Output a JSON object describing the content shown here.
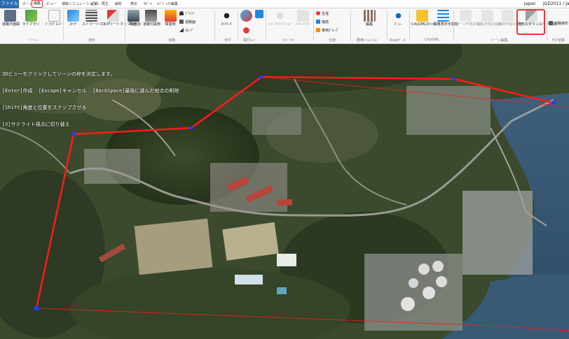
{
  "tabs": {
    "file": "ファイル",
    "items": [
      "ホーム",
      "編集",
      "ビュー",
      "運転シミュレーション",
      "記録／再生",
      "解析",
      "表示",
      "ｻﾎﾟｰﾄ",
      "ｵﾌﾞｼﾞｪｸﾄ編集"
    ],
    "active": "編集"
  },
  "status": {
    "lang": "Japan",
    "crs": "JGD2011 / Ja"
  },
  "ribbon": {
    "zone_group": {
      "label": "ゾーン",
      "roadplan": "道路平面図",
      "library": "ライブラリ",
      "drag_mode": "ﾄﾞﾗｯｸﾞﾓｰﾄﾞ"
    },
    "terrain_group": {
      "label": "地形",
      "sketch": "ｽｹｯﾁ",
      "street_map": "ストリートマップ",
      "street_map_split": "ストリートマップの分割"
    },
    "road_group": {
      "label": "道路",
      "section": "断面",
      "road_features": "道路付属物",
      "obstacles": "障害物",
      "bridge": "ﾌﾞﾘｯｼﾞ",
      "road_plane": "道路面",
      "slope": "ｽﾛｰﾌﾟ"
    },
    "walk_group": {
      "label": "歩行",
      "network": "ﾈｯﾄﾜｰｸ"
    },
    "flight_group": {
      "label": "飛行ﾙｰﾄ"
    },
    "headlight_group": {
      "label": "ﾍｯﾄﾞﾗｲﾄ",
      "headlight_option": "ﾍｯﾄﾞﾗｲﾄｵﾌﾟｼｮﾝ",
      "street_light": "ｽﾄﾘｰﾄﾗｲﾄ"
    },
    "traffic_group": {
      "label": "交通",
      "generate": "生成",
      "connect": "接続",
      "vehicle_group": "車両ｸﾞﾙｰﾌﾟ"
    },
    "crowd_group": {
      "label": "群衆ｼﾐｭﾚｰｼｮﾝ",
      "edit": "編集"
    },
    "road_data_group": {
      "label": "Roadﾃﾞｰﾀ",
      "view": "ﾋﾞｭｰ"
    },
    "citygml_group": {
      "label": "CityGML",
      "import": "CityGMLのｲﾝﾎﾟｰﾄ",
      "attr_display": "属性表示を開始"
    },
    "zone_edit_group": {
      "label": "ゾーン編集",
      "zone_create": "ゾーン作成の開始",
      "building_create": "ビル作成の開始",
      "forest_create": "森林作成の開始",
      "terrain_download": "地形のダウンロード開始"
    },
    "flt_group": {
      "label": "FLT道路",
      "road_edit": "道路縁形"
    }
  },
  "viewport": {
    "instructions": [
      "3Dビューをクリックしてゾーンの枠を決定します。",
      "[Enter]作成  [Escape]キャンセル  [BackSpace]最後に選んだ地点の削除",
      "[Shift]角度と位置をスナップさせる",
      "[V]サテライト視点に切り替え"
    ],
    "zone_line_color": "#ff1a1a",
    "vertex_color": "#1f3cff"
  }
}
